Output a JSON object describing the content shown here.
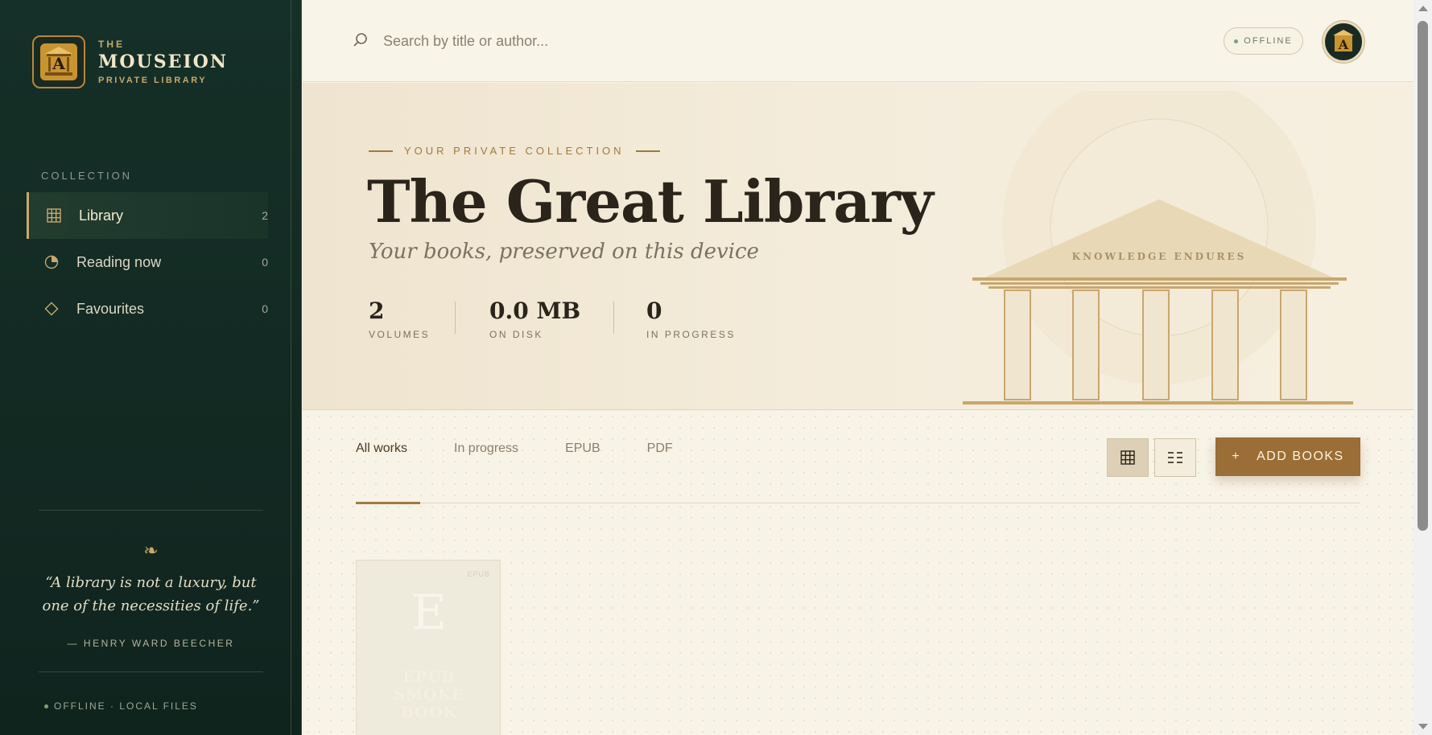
{
  "brand": {
    "the": "THE",
    "name": "MOUSEION",
    "sub": "PRIVATE LIBRARY",
    "logo_icon": "temple-logo-icon"
  },
  "sidebar": {
    "heading": "COLLECTION",
    "items": [
      {
        "label": "Library",
        "count": "2",
        "icon": "grid-icon",
        "active": true
      },
      {
        "label": "Reading now",
        "count": "0",
        "icon": "pie-icon",
        "active": false
      },
      {
        "label": "Favourites",
        "count": "0",
        "icon": "diamond-icon",
        "active": false
      }
    ],
    "fleuron": "❧",
    "quote": "“A library is not a luxury, but one of the necessities of life.”",
    "quote_author": "— HENRY WARD BEECHER",
    "status": "OFFLINE · LOCAL FILES"
  },
  "topbar": {
    "search_placeholder": "Search by title or author...",
    "search_value": "",
    "offline_label": "OFFLINE"
  },
  "hero": {
    "eyebrow": "YOUR PRIVATE COLLECTION",
    "title": "The Great Library",
    "subtitle": "Your books, preserved on this device",
    "stats": [
      {
        "value": "2",
        "label": "VOLUMES"
      },
      {
        "value": "0.0 MB",
        "label": "ON DISK"
      },
      {
        "value": "0",
        "label": "IN PROGRESS"
      }
    ],
    "temple_inscription": "KNOWLEDGE ENDURES"
  },
  "filters": {
    "tabs": [
      "All works",
      "In progress",
      "EPUB",
      "PDF"
    ],
    "active_tab": "All works",
    "add_label": "ADD BOOKS",
    "add_icon": "+"
  },
  "books": [
    {
      "letter": "E",
      "title_line1": "EPUB",
      "title_line2": "SMOKE",
      "title_line3": "BOOK",
      "tag": "EPUB"
    }
  ],
  "colors": {
    "sidebar_bg": "#153028",
    "accent_gold": "#c9a86a",
    "button_brown": "#9a6e36",
    "paper": "#f7f2e6"
  }
}
